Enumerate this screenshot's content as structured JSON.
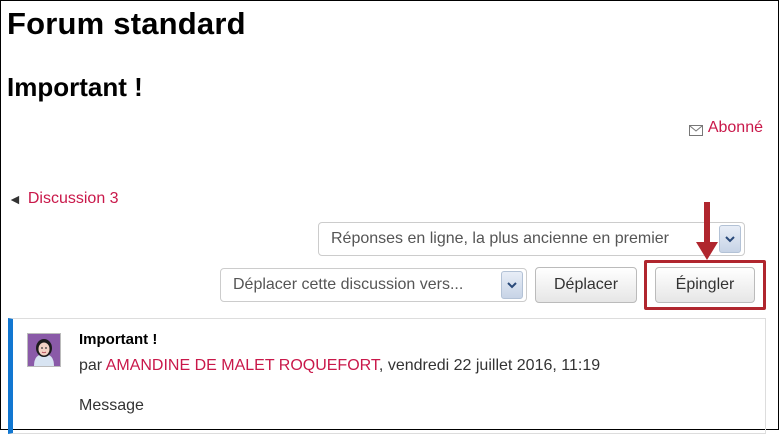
{
  "forum": {
    "title": "Forum standard"
  },
  "discussion": {
    "title": "Important !"
  },
  "subscription": {
    "label": "Abonné",
    "icon": "envelope-icon"
  },
  "navigation": {
    "prev_arrow": "◄",
    "prev_label": "Discussion 3"
  },
  "display_mode": {
    "selected": "Réponses en ligne, la plus ancienne en premier"
  },
  "move": {
    "selected": "Déplacer cette discussion vers...",
    "button_label": "Déplacer"
  },
  "pin": {
    "button_label": "Épingler"
  },
  "post": {
    "subject": "Important !",
    "by_prefix": "par ",
    "author": "AMANDINE DE MALET ROQUEFORT",
    "date": ", vendredi 22 juillet 2016, 11:19",
    "message": "Message"
  },
  "colors": {
    "link": "#c9184a",
    "annotation": "#b0262e",
    "post_accent": "#1177d1"
  }
}
